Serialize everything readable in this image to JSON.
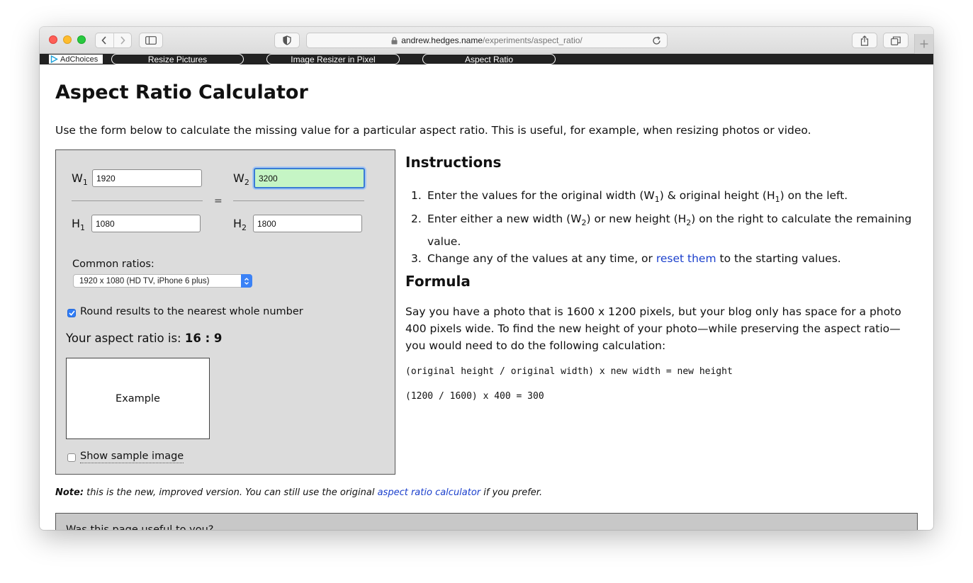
{
  "browser": {
    "url_domain": "andrew.hedges.name",
    "url_path": "/experiments/aspect_ratio/"
  },
  "adbar": {
    "adchoices": "AdChoices",
    "links": [
      "Resize Pictures",
      "Image Resizer in Pixel",
      "Aspect Ratio"
    ]
  },
  "page": {
    "title": "Aspect Ratio Calculator",
    "intro": "Use the form below to calculate the missing value for a particular aspect ratio. This is useful, for example, when resizing photos or video."
  },
  "calculator": {
    "w1_label": "W",
    "w2_label": "W",
    "h1_label": "H",
    "h2_label": "H",
    "sub1": "1",
    "sub2": "2",
    "equals": "=",
    "w1": "1920",
    "h1": "1080",
    "w2": "3200",
    "h2": "1800",
    "common_label": "Common ratios:",
    "selected_ratio": "1920 x 1080 (HD TV, iPhone 6 plus)",
    "round_label": "Round results to the nearest whole number",
    "round_checked": true,
    "ratio_prefix": "Your aspect ratio is: ",
    "ratio_value": "16 : 9",
    "example_label": "Example",
    "sample_label": "Show sample image",
    "sample_checked": false
  },
  "instructions": {
    "heading": "Instructions",
    "item1_a": "Enter the values for the original width (W",
    "item1_b": ") & original height (H",
    "item1_c": ") on the left.",
    "item2_a": "Enter either a new width (W",
    "item2_b": ") or new height (H",
    "item2_c": ") on the right to calculate the remaining value.",
    "item3_a": "Change any of the values at any time, or ",
    "item3_link": "reset them",
    "item3_b": " to the starting values.",
    "n1": "1.",
    "n2": "2.",
    "n3": "3."
  },
  "formula": {
    "heading": "Formula",
    "text": "Say you have a photo that is 1600 x 1200 pixels, but your blog only has space for a photo 400 pixels wide. To find the new height of your photo—while preserving the aspect ratio—you would need to do the following calculation:",
    "code1": "(original height / original width) x new width = new height",
    "code2": "(1200 / 1600) x 400 = 300"
  },
  "note": {
    "label": "Note:",
    "text_a": " this is the new, improved version. You can still use the original ",
    "link": "aspect ratio calculator",
    "text_b": " if you prefer."
  },
  "feedback": {
    "question": "Was this page useful to you?"
  }
}
